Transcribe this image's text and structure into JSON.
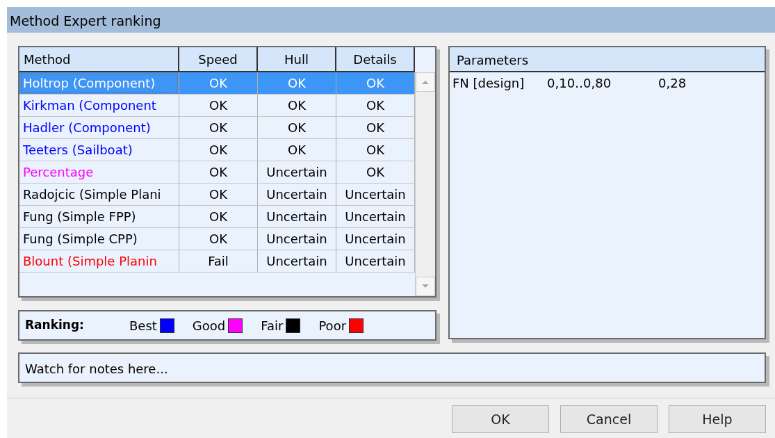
{
  "window": {
    "title": "Method Expert ranking"
  },
  "methods_table": {
    "columns": [
      "Method",
      "Speed",
      "Hull",
      "Details"
    ],
    "rows": [
      {
        "method": "Holtrop (Component)",
        "speed": "OK",
        "hull": "OK",
        "details": "OK",
        "selected": true
      },
      {
        "method": "Kirkman (Component",
        "color": "#0000ff",
        "speed": "OK",
        "hull": "OK",
        "details": "OK",
        "selected": false
      },
      {
        "method": "Hadler (Component)",
        "color": "#0000ff",
        "speed": "OK",
        "hull": "OK",
        "details": "OK",
        "selected": false
      },
      {
        "method": "Teeters (Sailboat)",
        "color": "#0000ff",
        "speed": "OK",
        "hull": "OK",
        "details": "OK",
        "selected": false
      },
      {
        "method": "Percentage",
        "color": "#ff00ff",
        "speed": "OK",
        "hull": "Uncertain",
        "details": "OK",
        "selected": false
      },
      {
        "method": "Radojcic (Simple Plani",
        "color": "#000000",
        "speed": "OK",
        "hull": "Uncertain",
        "details": "Uncertain",
        "selected": false
      },
      {
        "method": "Fung (Simple FPP)",
        "color": "#000000",
        "speed": "OK",
        "hull": "Uncertain",
        "details": "Uncertain",
        "selected": false
      },
      {
        "method": "Fung (Simple CPP)",
        "color": "#000000",
        "speed": "OK",
        "hull": "Uncertain",
        "details": "Uncertain",
        "selected": false
      },
      {
        "method": "Blount (Simple Planin",
        "color": "#ff0000",
        "speed": "Fail",
        "hull": "Uncertain",
        "details": "Uncertain",
        "selected": false
      }
    ]
  },
  "ranking": {
    "label": "Ranking:",
    "items": [
      {
        "label": "Best",
        "color": "#0000ff"
      },
      {
        "label": "Good",
        "color": "#ff00ff"
      },
      {
        "label": "Fair",
        "color": "#000000"
      },
      {
        "label": "Poor",
        "color": "#ff0000"
      }
    ]
  },
  "parameters": {
    "title": "Parameters",
    "rows": [
      {
        "name": "FN [design]",
        "range": "0,10‥0,80",
        "value": "0,28"
      }
    ]
  },
  "notes": "Watch for notes here...",
  "buttons": [
    "OK",
    "Cancel",
    "Help"
  ]
}
